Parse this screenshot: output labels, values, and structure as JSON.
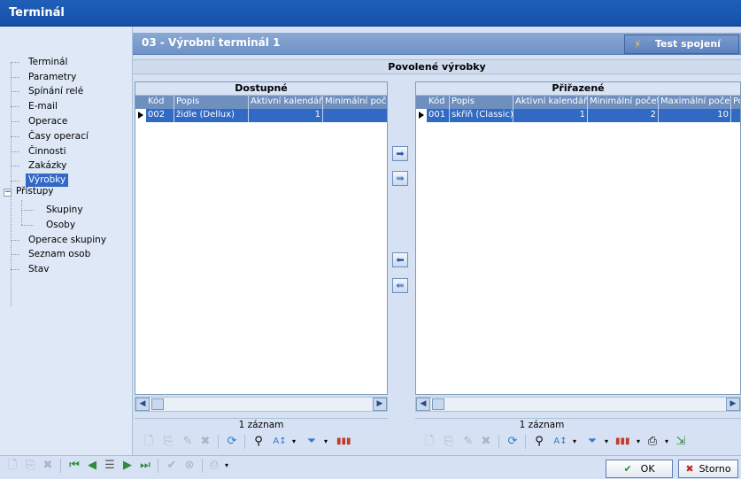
{
  "window": {
    "title": "Terminál"
  },
  "header": {
    "caption": "03  -  Výrobní terminál 1",
    "test_button": "Test spojení"
  },
  "tree": {
    "items": [
      {
        "label": "Terminál"
      },
      {
        "label": "Parametry"
      },
      {
        "label": "Spínání relé"
      },
      {
        "label": "E-mail"
      },
      {
        "label": "Operace"
      },
      {
        "label": "Časy operací"
      },
      {
        "label": "Činnosti"
      },
      {
        "label": "Zakázky"
      },
      {
        "label": "Výrobky",
        "selected": true
      },
      {
        "label": "Přístupy",
        "expanded": true
      },
      {
        "label": "Skupiny"
      },
      {
        "label": "Osoby"
      },
      {
        "label": "Operace skupiny"
      },
      {
        "label": "Seznam osob"
      },
      {
        "label": "Stav"
      }
    ]
  },
  "section": {
    "title": "Povolené výrobky"
  },
  "available": {
    "title": "Dostupné",
    "columns": [
      "Kód",
      "Popis",
      "Aktivní kalendář",
      "Minimální počet"
    ],
    "rows": [
      {
        "code": "002",
        "desc": "židle (Dellux)",
        "calendar": "1"
      }
    ],
    "status": "1 záznam"
  },
  "assigned": {
    "title": "Přiřazené",
    "columns": [
      "Kód",
      "Popis",
      "Aktivní kalendář",
      "Minimální počet",
      "Maximální počet",
      "Po"
    ],
    "rows": [
      {
        "code": "001",
        "desc": "skříň (Classic)",
        "calendar": "1",
        "min": "2",
        "max": "10"
      }
    ],
    "status": "1 záznam"
  },
  "buttons": {
    "ok": "OK",
    "cancel": "Storno"
  },
  "colors": {
    "selection": "#316ac5",
    "title_bar": "#1f5fb8",
    "header": "#6f92c6"
  }
}
